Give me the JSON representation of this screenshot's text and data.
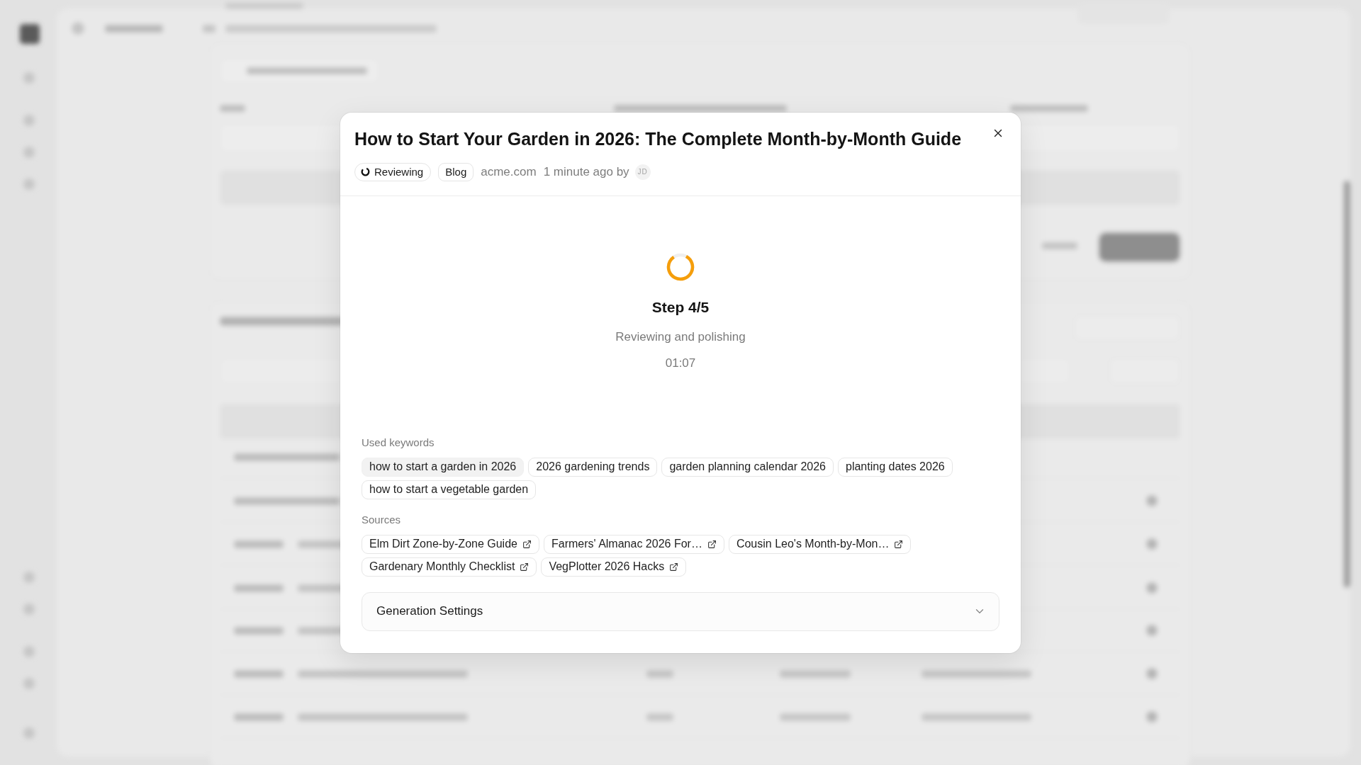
{
  "dialog": {
    "title": "How to Start Your Garden in 2026: The Complete Month-by-Month Guide",
    "status": {
      "label": "Reviewing",
      "kind": "in_progress"
    },
    "type_badge": "Blog",
    "site": "acme.com",
    "time": "1 minute ago by",
    "author_initials": "JD",
    "progress": {
      "step": "Step 4/5",
      "message": "Reviewing and polishing",
      "elapsed": "01:07"
    },
    "keywords": {
      "label": "Used keywords",
      "items": [
        {
          "text": "how to start a garden in 2026",
          "highlighted": true
        },
        {
          "text": "2026 gardening trends",
          "highlighted": false
        },
        {
          "text": "garden planning calendar 2026",
          "highlighted": false
        },
        {
          "text": "planting dates 2026",
          "highlighted": false
        },
        {
          "text": "how to start a vegetable garden",
          "highlighted": false
        }
      ]
    },
    "sources": {
      "label": "Sources",
      "items": [
        {
          "title": "Elm Dirt Zone-by-Zone Guide"
        },
        {
          "title": "Farmers' Almanac 2026 For…"
        },
        {
          "title": "Cousin Leo's Month-by-Mon…"
        },
        {
          "title": "Gardenary Monthly Checklist"
        },
        {
          "title": "VegPlotter 2026 Hacks"
        }
      ]
    },
    "settings_section": {
      "label": "Generation Settings",
      "expanded": false
    }
  }
}
